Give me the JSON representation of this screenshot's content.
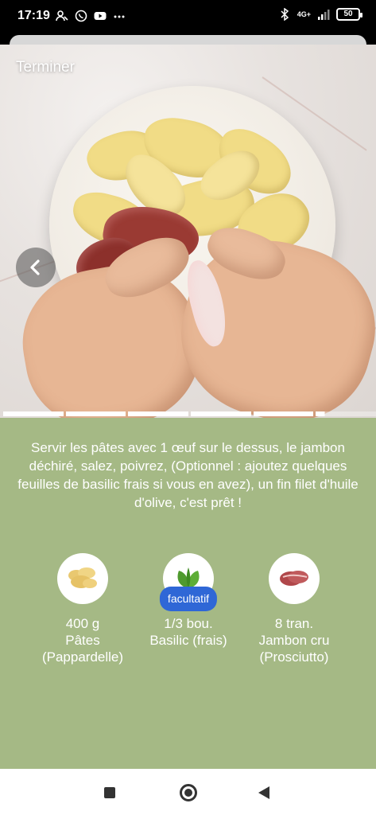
{
  "status": {
    "time": "17:19",
    "network": "4G+",
    "battery": "50"
  },
  "video": {
    "close_label": "Terminer",
    "back_icon": "chevron-left-icon",
    "steps_total": 6,
    "current_step": 6,
    "current_step_progress": 0.15
  },
  "step": {
    "instruction": "Servir les pâtes avec 1 œuf sur le dessus, le jambon déchiré, salez, poivrez, (Optionnel : ajoutez quelques feuilles de basilic frais si vous en avez), un fin filet d'huile d'olive, c'est prêt !"
  },
  "ingredients": [
    {
      "qty": "400 g",
      "name": "Pâtes",
      "detail": "(Pappardelle)",
      "badge": ""
    },
    {
      "qty": "1/3 bou.",
      "name": "Basilic (frais)",
      "detail": "",
      "badge": "facultatif"
    },
    {
      "qty": "8 tran.",
      "name": "Jambon cru",
      "detail": "(Prosciutto)",
      "badge": ""
    }
  ],
  "colors": {
    "panel": "#a5b985",
    "badge": "#2f67d6"
  }
}
